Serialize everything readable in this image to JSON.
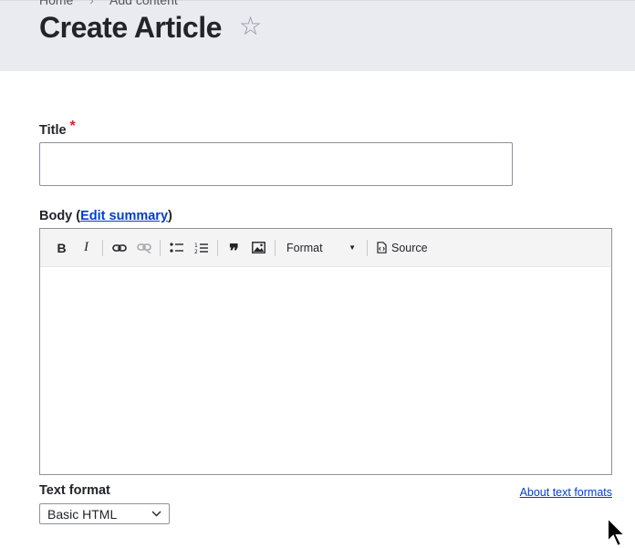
{
  "breadcrumb": {
    "home": "Home",
    "separator": "›",
    "add_content": "Add content"
  },
  "page": {
    "title": "Create Article"
  },
  "icons": {
    "star": "☆"
  },
  "fields": {
    "title": {
      "label": "Title",
      "required_mark": "*",
      "value": ""
    },
    "body": {
      "label_prefix": "Body (",
      "edit_summary": "Edit summary",
      "label_suffix": ")"
    }
  },
  "toolbar": {
    "buttons": [
      {
        "name": "bold-icon",
        "glyph": "B"
      },
      {
        "name": "italic-icon",
        "glyph": "I"
      },
      {
        "name": "link-icon",
        "glyph": "🔗"
      },
      {
        "name": "unlink-icon",
        "glyph": "⛓"
      },
      {
        "name": "bulleted-list-icon",
        "glyph": "•≡"
      },
      {
        "name": "numbered-list-icon",
        "glyph": "1≡"
      },
      {
        "name": "blockquote-icon",
        "glyph": "❞"
      },
      {
        "name": "image-icon",
        "glyph": "▣"
      }
    ],
    "format_label": "Format",
    "source_label": "Source"
  },
  "text_format": {
    "label": "Text format",
    "selected": "Basic HTML",
    "about_link": "About text formats"
  },
  "colors": {
    "header_bg": "#e9ebf1",
    "link": "#003ecc",
    "required": "#dc2323"
  }
}
